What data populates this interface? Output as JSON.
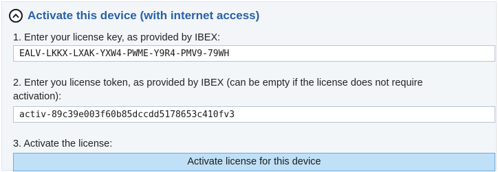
{
  "section": {
    "title": "Activate this device (with internet access)",
    "collapse_icon": "chevron-up-circle-icon"
  },
  "step1": {
    "label": "1. Enter your license key, as provided by IBEX:",
    "value": "EALV-LKKX-LXAK-YXW4-PWME-Y9R4-PMV9-79WH"
  },
  "step2": {
    "label": "2. Enter you license token, as provided by IBEX (can be empty if the license does not require activation):",
    "value": "activ-89c39e003f60b85dccdd5178653c410fv3"
  },
  "step3": {
    "label": "3. Activate the license:",
    "button_label": "Activate license for this device"
  },
  "colors": {
    "title": "#2862a8",
    "panel_background": "#f3f6f9",
    "button_background": "#bfe0f6",
    "button_border": "#6ea9d6"
  }
}
